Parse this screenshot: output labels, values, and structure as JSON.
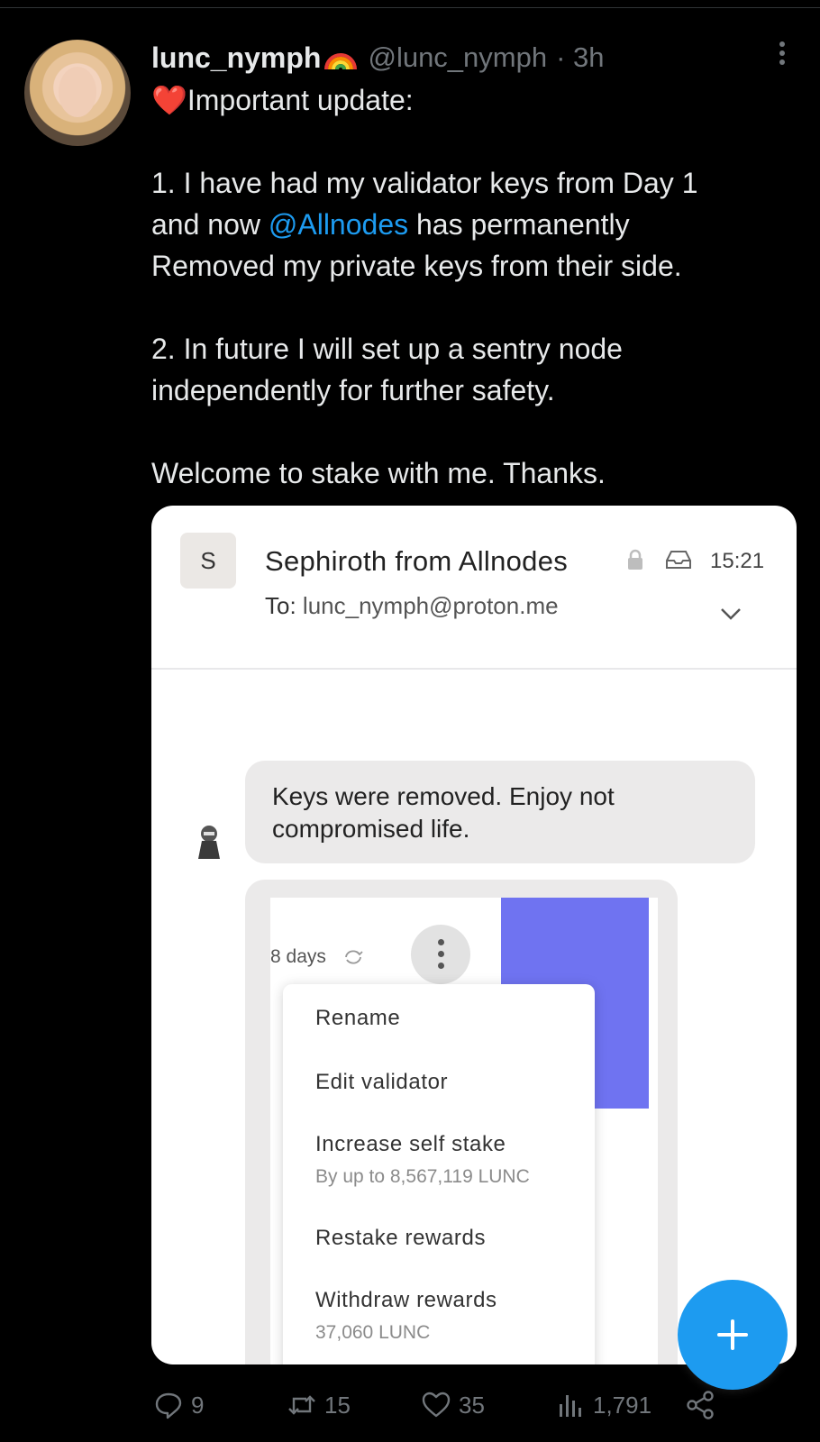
{
  "tweet": {
    "display_name": "lunc_nymph",
    "handle": "@lunc_nymph",
    "time": "· 3h",
    "line1": "Important update:",
    "para1_a": "1. I have had my validator keys from Day 1\nand now ",
    "mention": "@Allnodes",
    "para1_b": " has permanently\nRemoved my private keys from their side.",
    "para2": "2. In future I will set up a sentry node\nindependently for further safety.",
    "para3": "Welcome to stake with me. Thanks."
  },
  "email": {
    "sender_initial": "S",
    "sender": "Sephiroth from Allnodes",
    "time": "15:21",
    "to_label": "To:",
    "to_address": "lunc_nymph@proton.me",
    "message": "Keys were removed. Enjoy not compromised life."
  },
  "inner_screenshot": {
    "days": "8 days",
    "menu": [
      {
        "label": "Rename"
      },
      {
        "label": "Edit validator"
      },
      {
        "label": "Increase self stake",
        "sub": "By up to 8,567,119 LUNC"
      },
      {
        "label": "Restake rewards"
      },
      {
        "label": "Withdraw rewards",
        "sub": "37,060 LUNC"
      }
    ],
    "accent_color": "#6f73f1"
  },
  "actions": {
    "replies": "9",
    "retweets": "15",
    "likes": "35",
    "views": "1,791"
  },
  "colors": {
    "background": "#000000",
    "link": "#1d9bf0",
    "muted": "#71767b"
  }
}
